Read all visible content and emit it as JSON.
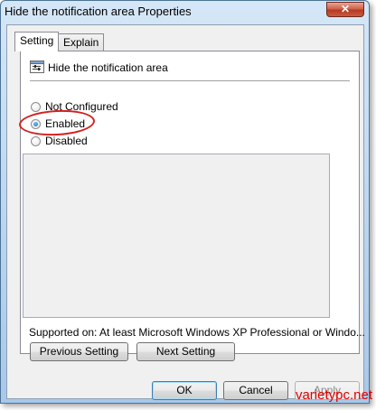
{
  "window": {
    "title": "Hide the notification area Properties",
    "close_glyph": "✕"
  },
  "tabs": [
    {
      "label": "Setting",
      "active": true
    },
    {
      "label": "Explain",
      "active": false
    }
  ],
  "policy": {
    "name": "Hide the notification area",
    "icon": "policy-settings-icon"
  },
  "options": [
    {
      "label": "Not Configured",
      "selected": false
    },
    {
      "label": "Enabled",
      "selected": true
    },
    {
      "label": "Disabled",
      "selected": false
    }
  ],
  "supported": {
    "label": "Supported on:",
    "value": "At least Microsoft Windows XP Professional or Windo..."
  },
  "nav_buttons": {
    "previous": "Previous Setting",
    "next": "Next Setting"
  },
  "dialog_buttons": {
    "ok": "OK",
    "cancel": "Cancel",
    "apply": "Apply"
  },
  "annotation_color": "#d42020",
  "watermark": "varietypc.net"
}
